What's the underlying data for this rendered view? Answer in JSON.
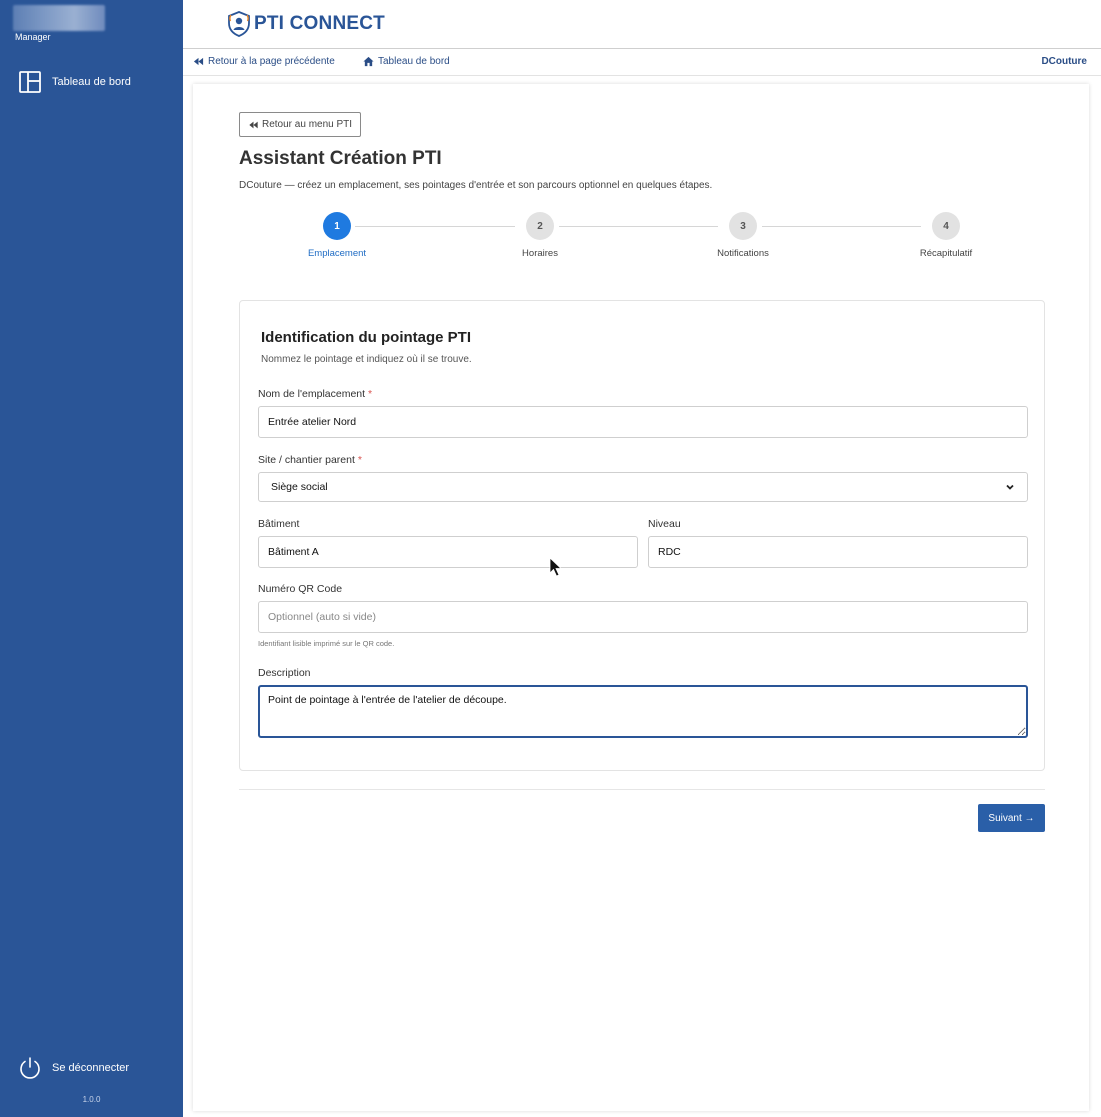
{
  "sidebar": {
    "role": "Manager",
    "items": [
      {
        "label": "Tableau de bord",
        "icon": "dashboard-icon"
      }
    ],
    "logout_label": "Se déconnecter",
    "version": "1.0.0"
  },
  "header": {
    "app_name": "PTI CONNECT",
    "brand_color": "#2a5597"
  },
  "breadcrumb": {
    "back_label": "Retour à la page précédente",
    "dashboard_label": "Tableau de bord",
    "user": "DCouture"
  },
  "page": {
    "back_menu_label": "Retour au menu PTI",
    "title": "Assistant Création PTI",
    "subtitle": "DCouture — créez un emplacement, ses pointages d'entrée et son parcours optionnel en quelques étapes."
  },
  "stepper": {
    "active_color": "#1f7ae0",
    "steps": [
      {
        "number": "1",
        "label": "Emplacement",
        "active": true
      },
      {
        "number": "2",
        "label": "Horaires",
        "active": false
      },
      {
        "number": "3",
        "label": "Notifications",
        "active": false
      },
      {
        "number": "4",
        "label": "Récapitulatif",
        "active": false
      }
    ]
  },
  "form": {
    "section_title": "Identification du pointage PTI",
    "section_subtitle": "Nommez le pointage et indiquez où il se trouve.",
    "required_marker": "*",
    "name": {
      "label": "Nom de l'emplacement",
      "value": "Entrée atelier Nord"
    },
    "site": {
      "label": "Site / chantier parent",
      "value": "Siège social"
    },
    "building": {
      "label": "Bâtiment",
      "value": "Bâtiment A"
    },
    "level": {
      "label": "Niveau",
      "value": "RDC"
    },
    "qr": {
      "label": "Numéro QR Code",
      "placeholder": "Optionnel (auto si vide)",
      "help": "Identifiant lisible imprimé sur le QR code."
    },
    "description": {
      "label": "Description",
      "value": "Point de pointage à l'entrée de l'atelier de découpe."
    }
  },
  "actions": {
    "next_label": "Suivant →"
  }
}
